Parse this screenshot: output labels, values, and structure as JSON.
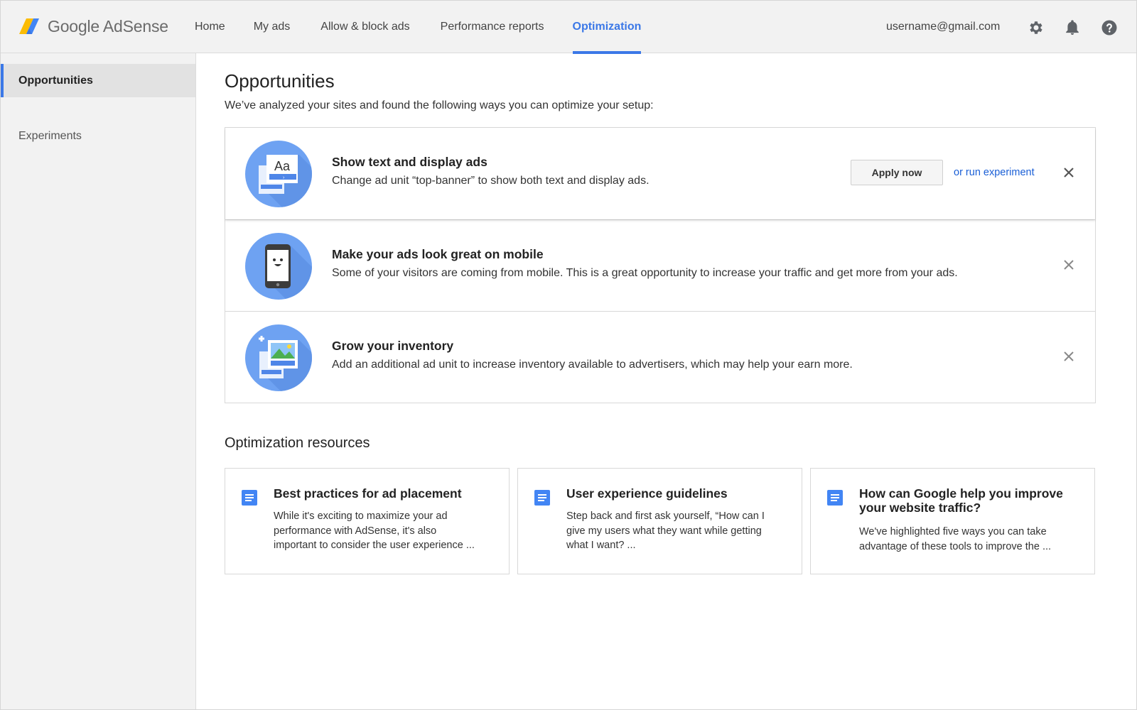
{
  "brand": {
    "name": "Google AdSense",
    "accent": "#3b78e7"
  },
  "nav": {
    "items": [
      {
        "label": "Home",
        "active": false
      },
      {
        "label": "My ads",
        "active": false
      },
      {
        "label": "Allow & block ads",
        "active": false
      },
      {
        "label": "Performance reports",
        "active": false
      },
      {
        "label": "Optimization",
        "active": true
      }
    ]
  },
  "account": {
    "email": "username@gmail.com"
  },
  "toolbar_icons": [
    "gear-icon",
    "bell-icon",
    "help-icon"
  ],
  "sidebar": {
    "items": [
      {
        "label": "Opportunities",
        "active": true
      },
      {
        "label": "Experiments",
        "active": false
      }
    ]
  },
  "main": {
    "title": "Opportunities",
    "subtitle": "We’ve analyzed your sites and found the following ways you can optimize your setup:",
    "opportunities": [
      {
        "title": "Show text and display ads",
        "description": "Change ad unit “top-banner” to show both text and display ads.",
        "apply_label": "Apply now",
        "experiment_label": "or run experiment",
        "icon": "text-display-ads-icon"
      },
      {
        "title": "Make your ads look great on mobile",
        "description": "Some of your visitors are coming from mobile. This is a great opportunity to increase your traffic and get more from your ads.",
        "icon": "mobile-phone-icon"
      },
      {
        "title": "Grow your inventory",
        "description": "Add an additional ad unit to increase inventory available to advertisers, which may help your earn more.",
        "icon": "add-inventory-icon"
      }
    ],
    "resources_title": "Optimization resources",
    "resources": [
      {
        "title": "Best practices for ad placement",
        "lines": [
          "While it's exciting to maximize your ad",
          "performance with AdSense, it's also",
          "important to consider the user experience ..."
        ]
      },
      {
        "title": "User experience guidelines",
        "lines": [
          "Step back and first ask yourself, “How can I",
          "give my users what they want while getting",
          "what I want? ..."
        ]
      },
      {
        "title": "How can Google help you improve your website traffic?",
        "lines": [
          "We've highlighted five ways you can take",
          "advantage of these tools to improve the ..."
        ]
      }
    ]
  }
}
